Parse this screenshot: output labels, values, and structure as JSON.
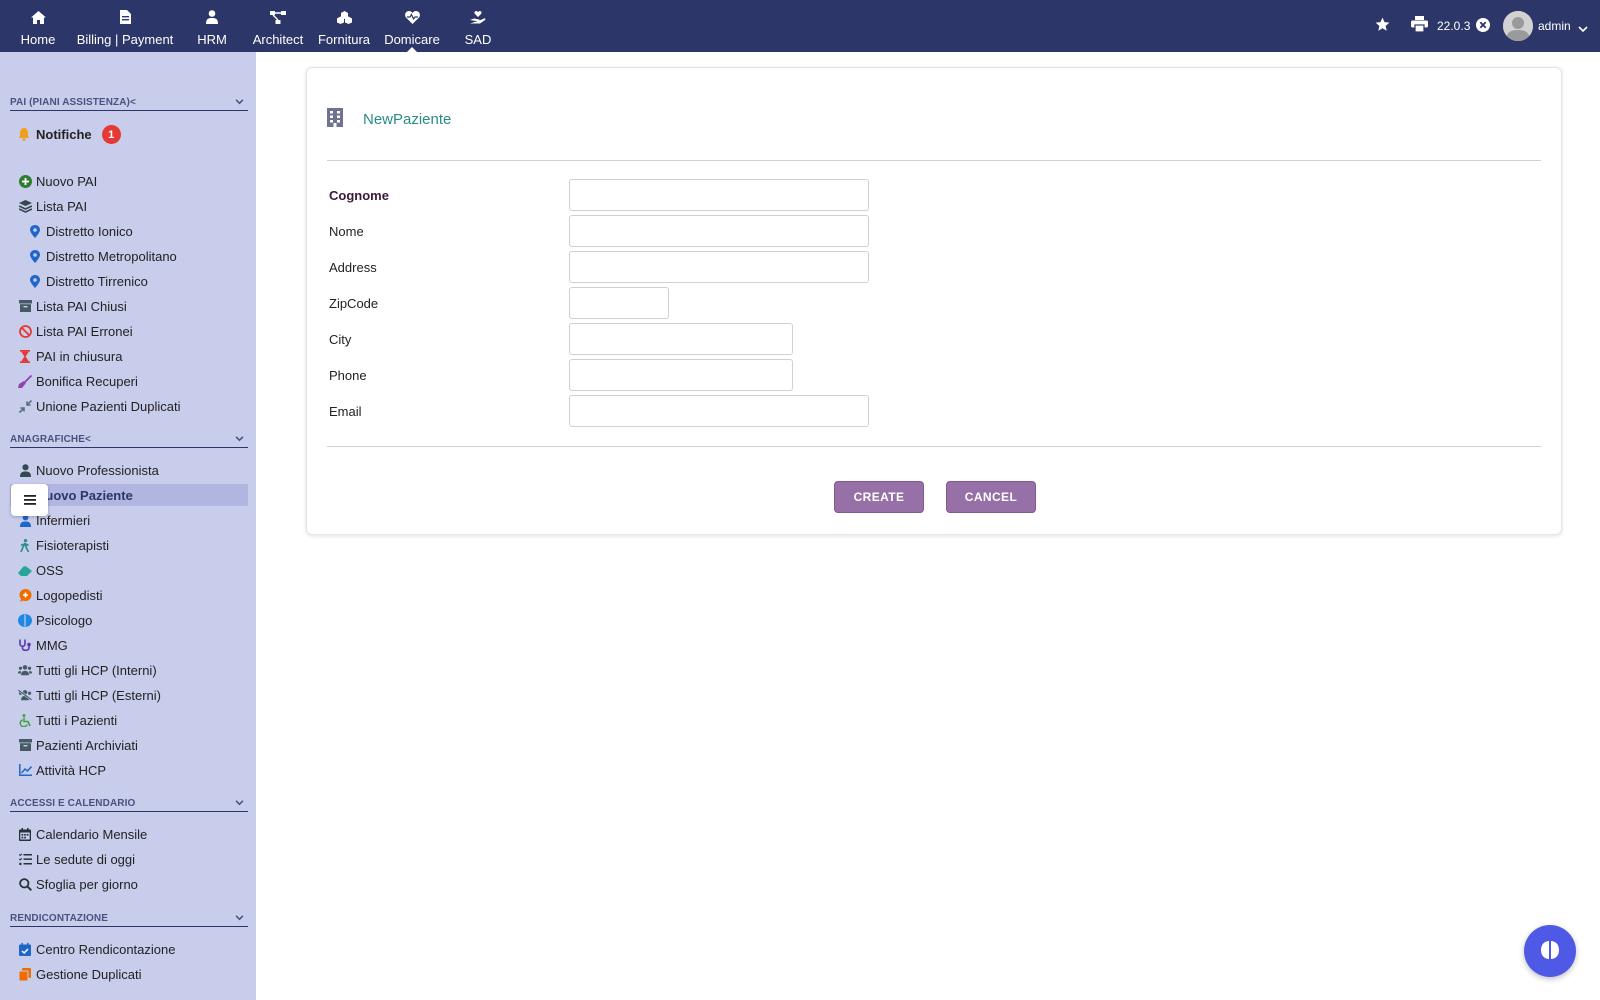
{
  "topnav": {
    "items": [
      {
        "label": "Home",
        "icon": "home-icon"
      },
      {
        "label": "Billing | Payment",
        "icon": "file-invoice-icon"
      },
      {
        "label": "HRM",
        "icon": "user-tie-icon"
      },
      {
        "label": "Architect",
        "icon": "project-diagram-icon"
      },
      {
        "label": "Fornitura",
        "icon": "cubes-icon"
      },
      {
        "label": "Domicare",
        "icon": "heart-pulse-icon"
      },
      {
        "label": "SAD",
        "icon": "hand-holding-heart-icon"
      }
    ],
    "active": "Domicare",
    "version": "22.0.3",
    "user": "admin"
  },
  "sidebar": {
    "sections": [
      {
        "title": "PAI (PIANI ASSISTENZA)<"
      },
      {
        "title": "ANAGRAFICHE<"
      },
      {
        "title": "ACCESSI E CALENDARIO"
      },
      {
        "title": "RENDICONTAZIONE"
      }
    ],
    "notifications": {
      "label": "Notifiche",
      "count": "1"
    },
    "pai_items": [
      {
        "label": "Nuovo PAI",
        "icon": "plus-circle-icon",
        "color": "#2e7d32"
      },
      {
        "label": "Lista PAI",
        "icon": "layers-icon",
        "color": "#37474f"
      },
      {
        "label": "Distretto Ionico",
        "icon": "map-marker-icon",
        "color": "#1e66c9"
      },
      {
        "label": "Distretto Metropolitano",
        "icon": "map-marker-icon",
        "color": "#1e66c9"
      },
      {
        "label": "Distretto Tirrenico",
        "icon": "map-marker-icon",
        "color": "#1e66c9"
      },
      {
        "label": "Lista PAI Chiusi",
        "icon": "archive-icon",
        "color": "#455a64"
      },
      {
        "label": "Lista PAI Erronei",
        "icon": "ban-icon",
        "color": "#e53935"
      },
      {
        "label": "PAI in chiusura",
        "icon": "hourglass-icon",
        "color": "#e53935"
      },
      {
        "label": "Bonifica Recuperi",
        "icon": "broom-icon",
        "color": "#8e44ad"
      },
      {
        "label": "Unione Pazienti Duplicati",
        "icon": "compress-icon",
        "color": "#546e7a"
      }
    ],
    "anagrafiche_items": [
      {
        "label": "Nuovo Professionista",
        "icon": "user-tie-icon",
        "color": "#37474f"
      },
      {
        "label": "Nuovo Paziente",
        "icon": "user-injured-icon",
        "color": "#37474f"
      },
      {
        "label": "Infermieri",
        "icon": "user-nurse-icon",
        "color": "#1e66c9"
      },
      {
        "label": "Fisioterapisti",
        "icon": "person-walking-icon",
        "color": "#2a8c86"
      },
      {
        "label": "OSS",
        "icon": "hands-icon",
        "color": "#26a69a"
      },
      {
        "label": "Logopedisti",
        "icon": "comment-medical-icon",
        "color": "#ef6c00"
      },
      {
        "label": "Psicologo",
        "icon": "brain-icon",
        "color": "#1e88e5"
      },
      {
        "label": "MMG",
        "icon": "stethoscope-icon",
        "color": "#5e35b1"
      },
      {
        "label": "Tutti gli HCP (Interni)",
        "icon": "users-icon",
        "color": "#455a64"
      },
      {
        "label": "Tutti gli HCP (Esterni)",
        "icon": "users-slash-icon",
        "color": "#455a64"
      },
      {
        "label": "Tutti i Pazienti",
        "icon": "wheelchair-icon",
        "color": "#43a047"
      },
      {
        "label": "Pazienti Archiviati",
        "icon": "archive-icon",
        "color": "#455a64"
      },
      {
        "label": "Attività HCP",
        "icon": "chart-line-icon",
        "color": "#1e66c9"
      }
    ],
    "accessi_items": [
      {
        "label": "Calendario Mensile",
        "icon": "calendar-icon",
        "color": "#263238"
      },
      {
        "label": "Le sedute di oggi",
        "icon": "list-check-icon",
        "color": "#263238"
      },
      {
        "label": "Sfoglia per giorno",
        "icon": "search-icon",
        "color": "#263238"
      }
    ],
    "rendicontazione_items": [
      {
        "label": "Centro Rendicontazione",
        "icon": "calendar-check-icon",
        "color": "#1e66c9"
      },
      {
        "label": "Gestione Duplicati",
        "icon": "copy-icon",
        "color": "#ef6c00"
      }
    ]
  },
  "form": {
    "title": "NewPaziente",
    "fields": [
      {
        "label": "Cognome",
        "value": ""
      },
      {
        "label": "Nome",
        "value": ""
      },
      {
        "label": "Address",
        "value": ""
      },
      {
        "label": "ZipCode",
        "value": ""
      },
      {
        "label": "City",
        "value": ""
      },
      {
        "label": "Phone",
        "value": ""
      },
      {
        "label": "Email",
        "value": ""
      }
    ],
    "create_label": "CREATE",
    "cancel_label": "CANCEL"
  },
  "colors": {
    "topbar": "#2c3668",
    "sidebar": "#c9cdec",
    "accent_title": "#2a8c86",
    "button": "#9670a6",
    "badge": "#e53935",
    "fab": "#4e5ae6"
  }
}
